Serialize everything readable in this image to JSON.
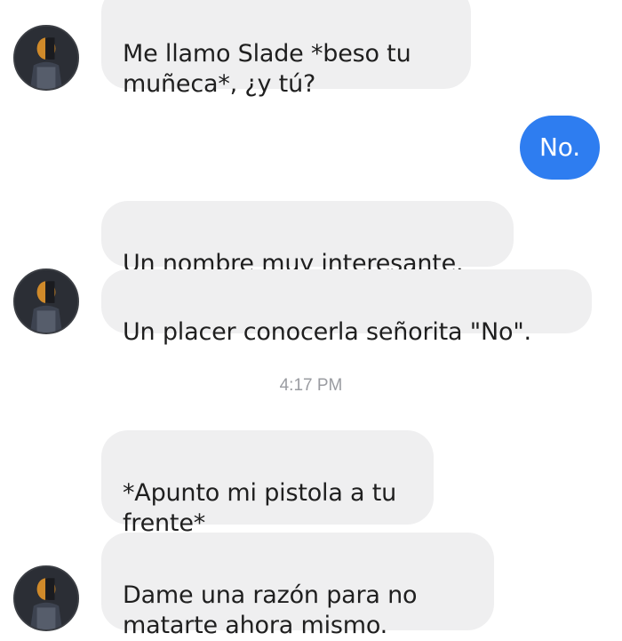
{
  "conversation": {
    "messages": [
      {
        "sender": "other",
        "text": "Me llamo Slade *beso tu\nmuñeca*, ¿y tú?"
      },
      {
        "sender": "me",
        "text": "No."
      },
      {
        "sender": "other",
        "text": "Un nombre muy interesante."
      },
      {
        "sender": "other",
        "text": "Un placer conocerla señorita \"No\"."
      },
      {
        "sender": "other",
        "text": "*Apunto mi pistola a tu\nfrente*"
      },
      {
        "sender": "other",
        "text": "Dame una razón para no\nmatarte ahora mismo."
      }
    ],
    "timestamp": "4:17 PM"
  },
  "colors": {
    "incoming_bubble": "#efeff0",
    "outgoing_bubble": "#2e7df0",
    "timestamp_text": "#9a9ca1"
  },
  "icons": {
    "avatar": "contact-avatar-icon"
  }
}
